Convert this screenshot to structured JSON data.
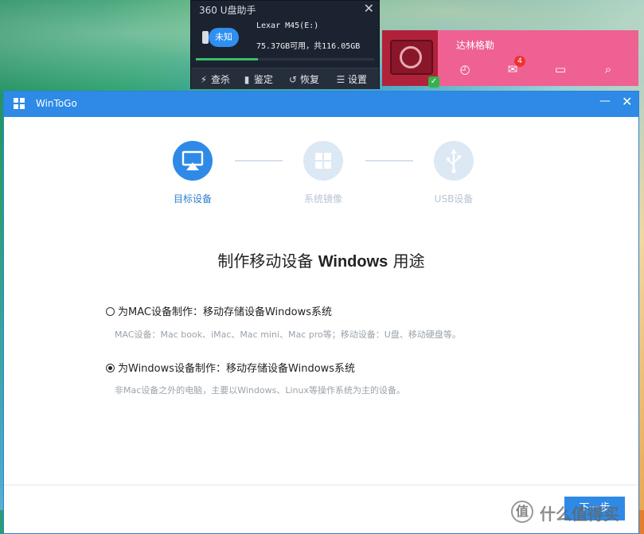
{
  "usb_helper": {
    "title": "360 U盘助手",
    "close_icon": "close-icon",
    "device_badge": "未知",
    "device_name": "Lexar M45(E:)",
    "capacity": "75.37GB可用，共116.05GB",
    "usage_fraction": 0.35,
    "actions": [
      {
        "label": "查杀",
        "icon": "lightning-icon",
        "glyph": "⚡"
      },
      {
        "label": "鉴定",
        "icon": "shield-icon",
        "glyph": "▮"
      },
      {
        "label": "恢复",
        "icon": "restore-icon",
        "glyph": "↺"
      },
      {
        "label": "设置",
        "icon": "menu-icon",
        "glyph": "☰"
      }
    ]
  },
  "user_widget": {
    "name": "达林格勒",
    "mail_count": "4",
    "icons": [
      "clock-icon",
      "mail-icon",
      "window-icon",
      "search-icon"
    ],
    "accent": "#ee6192"
  },
  "window": {
    "title": "WinToGo",
    "accent": "#2e8ae6",
    "steps": [
      {
        "label": "目标设备",
        "icon": "airplay-icon",
        "active": true
      },
      {
        "label": "系统镜像",
        "icon": "windows-icon",
        "active": false
      },
      {
        "label": "USB设备",
        "icon": "usb-icon",
        "active": false
      }
    ],
    "heading_prefix": "制作移动设备 ",
    "heading_bold": "Windows",
    "heading_suffix": " 用途",
    "options": [
      {
        "label": "为MAC设备制作：移动存储设备Windows系统",
        "description": "MAC设备：Mac book、iMac、Mac mini、Mac pro等；移动设备：U盘、移动硬盘等。",
        "selected": false
      },
      {
        "label": "为Windows设备制作：移动存储设备Windows系统",
        "description": "非Mac设备之外的电脑，主要以Windows、Linux等操作系统为主的设备。",
        "selected": true
      }
    ],
    "next_label": "下一步"
  },
  "watermark": {
    "glyph": "值",
    "text": "什么值得买"
  }
}
